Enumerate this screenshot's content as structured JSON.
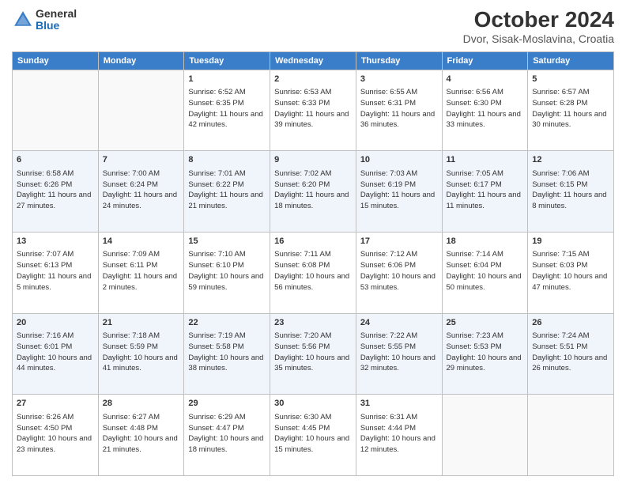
{
  "header": {
    "title": "October 2024",
    "subtitle": "Dvor, Sisak-Moslavina, Croatia",
    "logo_general": "General",
    "logo_blue": "Blue"
  },
  "days_of_week": [
    "Sunday",
    "Monday",
    "Tuesday",
    "Wednesday",
    "Thursday",
    "Friday",
    "Saturday"
  ],
  "weeks": [
    [
      {
        "day": "",
        "empty": true
      },
      {
        "day": "",
        "empty": true
      },
      {
        "day": "1",
        "sunrise": "6:52 AM",
        "sunset": "6:35 PM",
        "daylight": "11 hours and 42 minutes."
      },
      {
        "day": "2",
        "sunrise": "6:53 AM",
        "sunset": "6:33 PM",
        "daylight": "11 hours and 39 minutes."
      },
      {
        "day": "3",
        "sunrise": "6:55 AM",
        "sunset": "6:31 PM",
        "daylight": "11 hours and 36 minutes."
      },
      {
        "day": "4",
        "sunrise": "6:56 AM",
        "sunset": "6:30 PM",
        "daylight": "11 hours and 33 minutes."
      },
      {
        "day": "5",
        "sunrise": "6:57 AM",
        "sunset": "6:28 PM",
        "daylight": "11 hours and 30 minutes."
      }
    ],
    [
      {
        "day": "6",
        "sunrise": "6:58 AM",
        "sunset": "6:26 PM",
        "daylight": "11 hours and 27 minutes."
      },
      {
        "day": "7",
        "sunrise": "7:00 AM",
        "sunset": "6:24 PM",
        "daylight": "11 hours and 24 minutes."
      },
      {
        "day": "8",
        "sunrise": "7:01 AM",
        "sunset": "6:22 PM",
        "daylight": "11 hours and 21 minutes."
      },
      {
        "day": "9",
        "sunrise": "7:02 AM",
        "sunset": "6:20 PM",
        "daylight": "11 hours and 18 minutes."
      },
      {
        "day": "10",
        "sunrise": "7:03 AM",
        "sunset": "6:19 PM",
        "daylight": "11 hours and 15 minutes."
      },
      {
        "day": "11",
        "sunrise": "7:05 AM",
        "sunset": "6:17 PM",
        "daylight": "11 hours and 11 minutes."
      },
      {
        "day": "12",
        "sunrise": "7:06 AM",
        "sunset": "6:15 PM",
        "daylight": "11 hours and 8 minutes."
      }
    ],
    [
      {
        "day": "13",
        "sunrise": "7:07 AM",
        "sunset": "6:13 PM",
        "daylight": "11 hours and 5 minutes."
      },
      {
        "day": "14",
        "sunrise": "7:09 AM",
        "sunset": "6:11 PM",
        "daylight": "11 hours and 2 minutes."
      },
      {
        "day": "15",
        "sunrise": "7:10 AM",
        "sunset": "6:10 PM",
        "daylight": "10 hours and 59 minutes."
      },
      {
        "day": "16",
        "sunrise": "7:11 AM",
        "sunset": "6:08 PM",
        "daylight": "10 hours and 56 minutes."
      },
      {
        "day": "17",
        "sunrise": "7:12 AM",
        "sunset": "6:06 PM",
        "daylight": "10 hours and 53 minutes."
      },
      {
        "day": "18",
        "sunrise": "7:14 AM",
        "sunset": "6:04 PM",
        "daylight": "10 hours and 50 minutes."
      },
      {
        "day": "19",
        "sunrise": "7:15 AM",
        "sunset": "6:03 PM",
        "daylight": "10 hours and 47 minutes."
      }
    ],
    [
      {
        "day": "20",
        "sunrise": "7:16 AM",
        "sunset": "6:01 PM",
        "daylight": "10 hours and 44 minutes."
      },
      {
        "day": "21",
        "sunrise": "7:18 AM",
        "sunset": "5:59 PM",
        "daylight": "10 hours and 41 minutes."
      },
      {
        "day": "22",
        "sunrise": "7:19 AM",
        "sunset": "5:58 PM",
        "daylight": "10 hours and 38 minutes."
      },
      {
        "day": "23",
        "sunrise": "7:20 AM",
        "sunset": "5:56 PM",
        "daylight": "10 hours and 35 minutes."
      },
      {
        "day": "24",
        "sunrise": "7:22 AM",
        "sunset": "5:55 PM",
        "daylight": "10 hours and 32 minutes."
      },
      {
        "day": "25",
        "sunrise": "7:23 AM",
        "sunset": "5:53 PM",
        "daylight": "10 hours and 29 minutes."
      },
      {
        "day": "26",
        "sunrise": "7:24 AM",
        "sunset": "5:51 PM",
        "daylight": "10 hours and 26 minutes."
      }
    ],
    [
      {
        "day": "27",
        "sunrise": "6:26 AM",
        "sunset": "4:50 PM",
        "daylight": "10 hours and 23 minutes."
      },
      {
        "day": "28",
        "sunrise": "6:27 AM",
        "sunset": "4:48 PM",
        "daylight": "10 hours and 21 minutes."
      },
      {
        "day": "29",
        "sunrise": "6:29 AM",
        "sunset": "4:47 PM",
        "daylight": "10 hours and 18 minutes."
      },
      {
        "day": "30",
        "sunrise": "6:30 AM",
        "sunset": "4:45 PM",
        "daylight": "10 hours and 15 minutes."
      },
      {
        "day": "31",
        "sunrise": "6:31 AM",
        "sunset": "4:44 PM",
        "daylight": "10 hours and 12 minutes."
      },
      {
        "day": "",
        "empty": true
      },
      {
        "day": "",
        "empty": true
      }
    ]
  ]
}
